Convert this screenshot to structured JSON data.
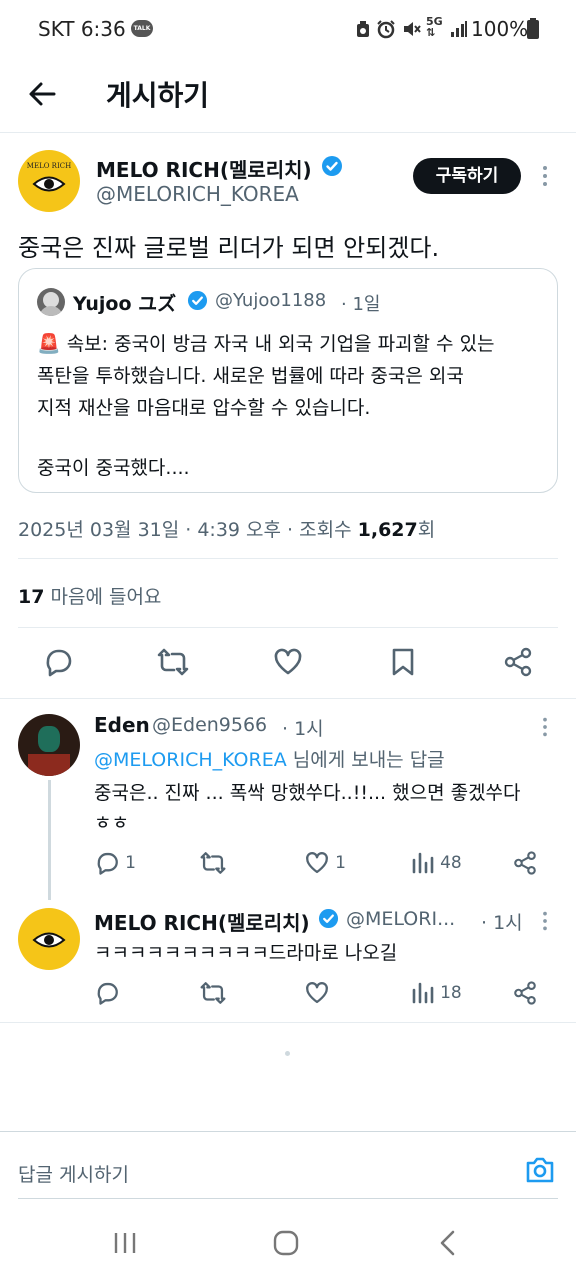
{
  "status_bar": {
    "carrier_time": "SKT 6:36",
    "talk_badge": "TALK",
    "network": "5G",
    "battery": "100%"
  },
  "header": {
    "title": "게시하기"
  },
  "post": {
    "display_name": "MELO RICH(멜로리치)",
    "handle": "@MELORICH_KOREA",
    "avatar_text": "MELO RICH",
    "subscribe_label": "구독하기",
    "text": "중국은 진짜 글로벌 리더가 되면 안되겠다.",
    "quote": {
      "display_name": "Yujoo ユズ",
      "handle": "@Yujoo1188",
      "time": "· 1일",
      "line1": "🚨 속보: 중국이 방금 자국 내 외국 기업을 파괴할 수 있는",
      "line2": "폭탄을 투하했습니다. 새로운 법률에 따라 중국은 외국",
      "line3": "지적 재산을 마음대로 압수할 수 있습니다.",
      "line4": "중국이 중국했다...."
    },
    "meta_date": "2025년 03월 31일 · 4:39 오후 · 조회수 ",
    "views": "1,627",
    "views_suffix": "회",
    "likes_count": "17",
    "likes_label": " 마음에 들어요"
  },
  "replies": [
    {
      "display_name": "Eden",
      "handle": "@Eden9566",
      "time": "· 1시",
      "reply_to_mention": "@MELORICH_KOREA",
      "reply_to_suffix": " 님에게 보내는 답글",
      "line1": "중국은.. 진짜 ... 폭싹 망했쑤다..!!... 했으면 좋겠쑤다",
      "line2": "ㅎㅎ",
      "reply_count": "1",
      "like_count": "1",
      "view_count": "48"
    },
    {
      "display_name": "MELO RICH(멜로리치)",
      "handle": "@MELORI...",
      "time": "· 1시",
      "text": "ㅋㅋㅋㅋㅋㅋㅋㅋㅋㅋ드라마로 나오길",
      "view_count": "18"
    }
  ],
  "composer": {
    "placeholder": "답글 게시하기"
  },
  "colors": {
    "accent": "#1d9bf0",
    "avatar_yellow": "#f5c518",
    "text_primary": "#0f1419",
    "text_muted": "#536471"
  }
}
